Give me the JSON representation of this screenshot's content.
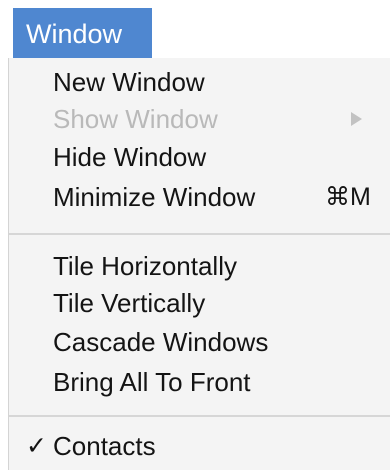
{
  "menu_bar": {
    "title": "Window",
    "highlight_color": "#4f87d0"
  },
  "menu": {
    "group1": {
      "new_window": "New Window",
      "show_window": "Show Window",
      "show_window_submenu_icon": "triangle-right-icon",
      "hide_window": "Hide Window",
      "minimize_window": "Minimize Window",
      "minimize_shortcut": "⌘M"
    },
    "group2": {
      "tile_horizontally": "Tile Horizontally",
      "tile_vertically": "Tile Vertically",
      "cascade_windows": "Cascade Windows",
      "bring_all_to_front": "Bring All To Front"
    },
    "group3": {
      "contacts_checkmark": "✓",
      "contacts": "Contacts",
      "contacts_checked": true
    }
  }
}
